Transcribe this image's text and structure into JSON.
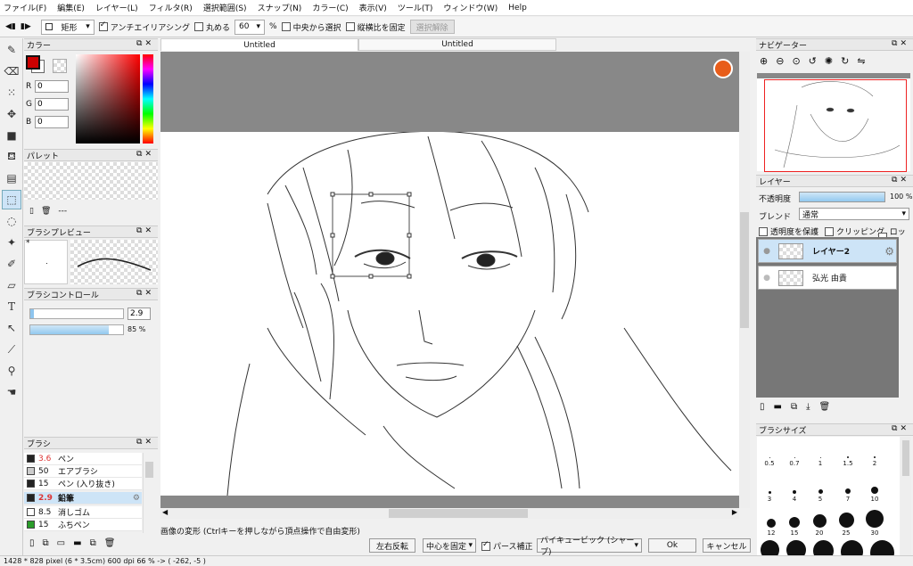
{
  "menu": [
    "ファイル(F)",
    "編集(E)",
    "レイヤー(L)",
    "フィルタ(R)",
    "選択範囲(S)",
    "スナップ(N)",
    "カラー(C)",
    "表示(V)",
    "ツール(T)",
    "ウィンドウ(W)",
    "Help"
  ],
  "toolbar": {
    "shape_value": "矩形",
    "antialias_label": "アンチエイリアシング",
    "round_label": "丸める",
    "round_value": "60",
    "round_unit": "%",
    "center_label": "中央から選択",
    "aspect_label": "縦横比を固定",
    "deselect_label": "選択解除"
  },
  "color_panel": {
    "title": "カラー",
    "r_label": "R",
    "g_label": "G",
    "b_label": "B",
    "r": "0",
    "g": "0",
    "b": "0",
    "fg_color": "#cc0000"
  },
  "palette_panel": {
    "title": "パレット",
    "value": "---"
  },
  "brush_preview_panel": {
    "title": "ブラシプレビュー",
    "marker": "*"
  },
  "brush_control_panel": {
    "title": "ブラシコントロール",
    "size": "2.9",
    "opacity": "85 %",
    "opacity_level": 0.85
  },
  "brush_panel": {
    "title": "ブラシ",
    "items": [
      {
        "size": "3.6",
        "name": "ペン",
        "color": "#222222",
        "size_color": "#d33"
      },
      {
        "size": "50",
        "name": "エアブラシ",
        "color": "#cccccc",
        "size_color": "#111"
      },
      {
        "size": "15",
        "name": "ペン (入り抜き)",
        "color": "#222222",
        "size_color": "#111"
      },
      {
        "size": "2.9",
        "name": "鉛筆",
        "color": "#222222",
        "size_color": "#d33",
        "selected": true
      },
      {
        "size": "8.5",
        "name": "消しゴム",
        "color": "#ffffff",
        "size_color": "#111"
      },
      {
        "size": "15",
        "name": "ふちペン",
        "color": "#2a9d2a",
        "size_color": "#111"
      }
    ]
  },
  "tabs": [
    "Untitled",
    "Untitled"
  ],
  "transform_bar": {
    "hint": "画像の変形 (Ctrlキーを押しながら頂点操作で自由変形)",
    "flip": "左右反転",
    "anchor": "中心を固定",
    "perspective": "パース補正",
    "interp": "バイキュービック (シャープ)",
    "ok": "Ok",
    "cancel": "キャンセル"
  },
  "statusbar": "1428 * 828 pixel  (6 * 3.5cm)  600 dpi  66 %  -> ( -262, -5 )",
  "navigator_panel": {
    "title": "ナビゲーター"
  },
  "layer_panel": {
    "title": "レイヤー",
    "opacity_label": "不透明度",
    "opacity_value": "100 %",
    "blend_label": "ブレンド",
    "blend_value": "通常",
    "protect_label": "透明度を保護",
    "clip_label": "クリッピング",
    "lock_label": "ロック",
    "layers": [
      "レイヤー2",
      "弘光 由貴"
    ]
  },
  "brush_size_panel": {
    "title": "ブラシサイズ",
    "sizes": [
      "0.5",
      "0.7",
      "1",
      "1.5",
      "2",
      "3",
      "4",
      "5",
      "7",
      "10",
      "12",
      "15",
      "20",
      "25",
      "30"
    ]
  }
}
